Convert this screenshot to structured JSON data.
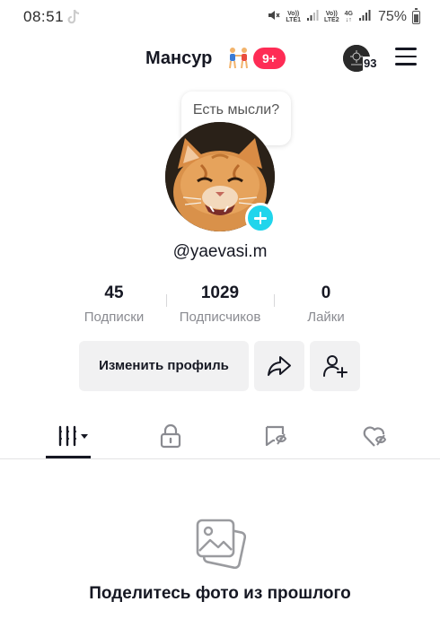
{
  "status_bar": {
    "time": "08:51",
    "sim1_top": "Vo))",
    "sim1_bottom": "LTE1",
    "sim2_top": "Vo))",
    "sim2_bottom": "LTE2",
    "network": "4G",
    "battery": "75%"
  },
  "profile": {
    "username": "Мансур",
    "notification_badge": "9+",
    "coins": "93",
    "handle": "@yaevasi.m",
    "thought_bubble": "Есть мысли?"
  },
  "stats": [
    {
      "value": "45",
      "label": "Подписки"
    },
    {
      "value": "1029",
      "label": "Подписчиков"
    },
    {
      "value": "0",
      "label": "Лайки"
    }
  ],
  "actions": {
    "edit_profile": "Изменить профиль"
  },
  "tabs": [
    {
      "icon": "grid-icon",
      "active": true
    },
    {
      "icon": "lock-icon",
      "active": false
    },
    {
      "icon": "tagged-icon",
      "active": false
    },
    {
      "icon": "liked-heart-icon",
      "active": false
    }
  ],
  "empty_state": {
    "icon": "photos-icon",
    "text": "Поделитесь фото из прошлого"
  },
  "colors": {
    "badge": "#fe2c55",
    "accent": "#20d5ec",
    "button_bg": "#f1f1f2",
    "muted_text": "#8a8b91"
  }
}
